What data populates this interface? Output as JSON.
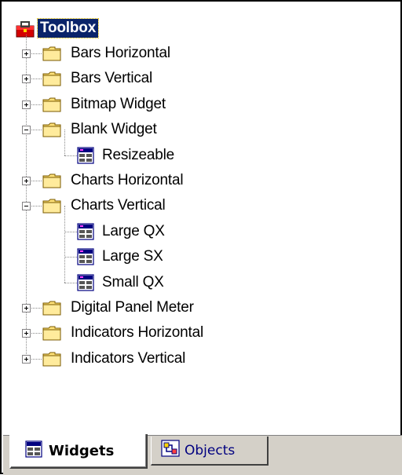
{
  "tree": {
    "root_label": "Toolbox",
    "nodes": [
      {
        "label": "Bars Horizontal",
        "type": "folder",
        "state": "collapsed"
      },
      {
        "label": "Bars Vertical",
        "type": "folder",
        "state": "collapsed"
      },
      {
        "label": "Bitmap Widget",
        "type": "folder",
        "state": "collapsed"
      },
      {
        "label": "Blank Widget",
        "type": "folder",
        "state": "expanded"
      },
      {
        "label": "Resizeable",
        "type": "widget",
        "state": "leaf"
      },
      {
        "label": "Charts Horizontal",
        "type": "folder",
        "state": "collapsed"
      },
      {
        "label": "Charts Vertical",
        "type": "folder",
        "state": "expanded"
      },
      {
        "label": "Large QX",
        "type": "widget",
        "state": "leaf"
      },
      {
        "label": "Large SX",
        "type": "widget",
        "state": "leaf"
      },
      {
        "label": "Small QX",
        "type": "widget",
        "state": "leaf"
      },
      {
        "label": "Digital Panel Meter",
        "type": "folder",
        "state": "collapsed"
      },
      {
        "label": "Indicators Horizontal",
        "type": "folder",
        "state": "collapsed"
      },
      {
        "label": "Indicators Vertical",
        "type": "folder",
        "state": "collapsed"
      }
    ]
  },
  "tabs": {
    "widgets_label": "Widgets",
    "objects_label": "Objects"
  },
  "colors": {
    "selection": "#0a246a",
    "folder": "#ffe27a",
    "tab_bar": "#d4d0c8"
  },
  "icons": {
    "root": "toolbox-icon",
    "folder": "folder-icon",
    "widget": "widget-icon"
  }
}
